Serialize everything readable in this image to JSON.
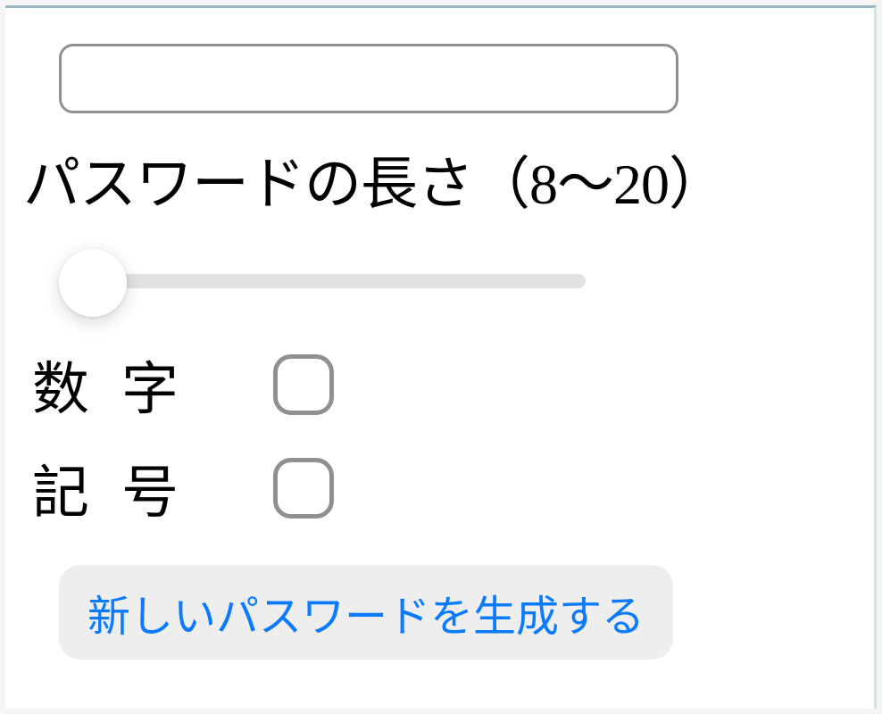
{
  "password": {
    "value": "",
    "placeholder": ""
  },
  "length": {
    "label": "パスワードの長さ（8〜20）",
    "min": 8,
    "max": 20,
    "value": 8
  },
  "options": {
    "numbers": {
      "label": "数字",
      "checked": false
    },
    "symbols": {
      "label": "記号",
      "checked": false
    }
  },
  "button": {
    "generate": "新しいパスワードを生成する"
  }
}
